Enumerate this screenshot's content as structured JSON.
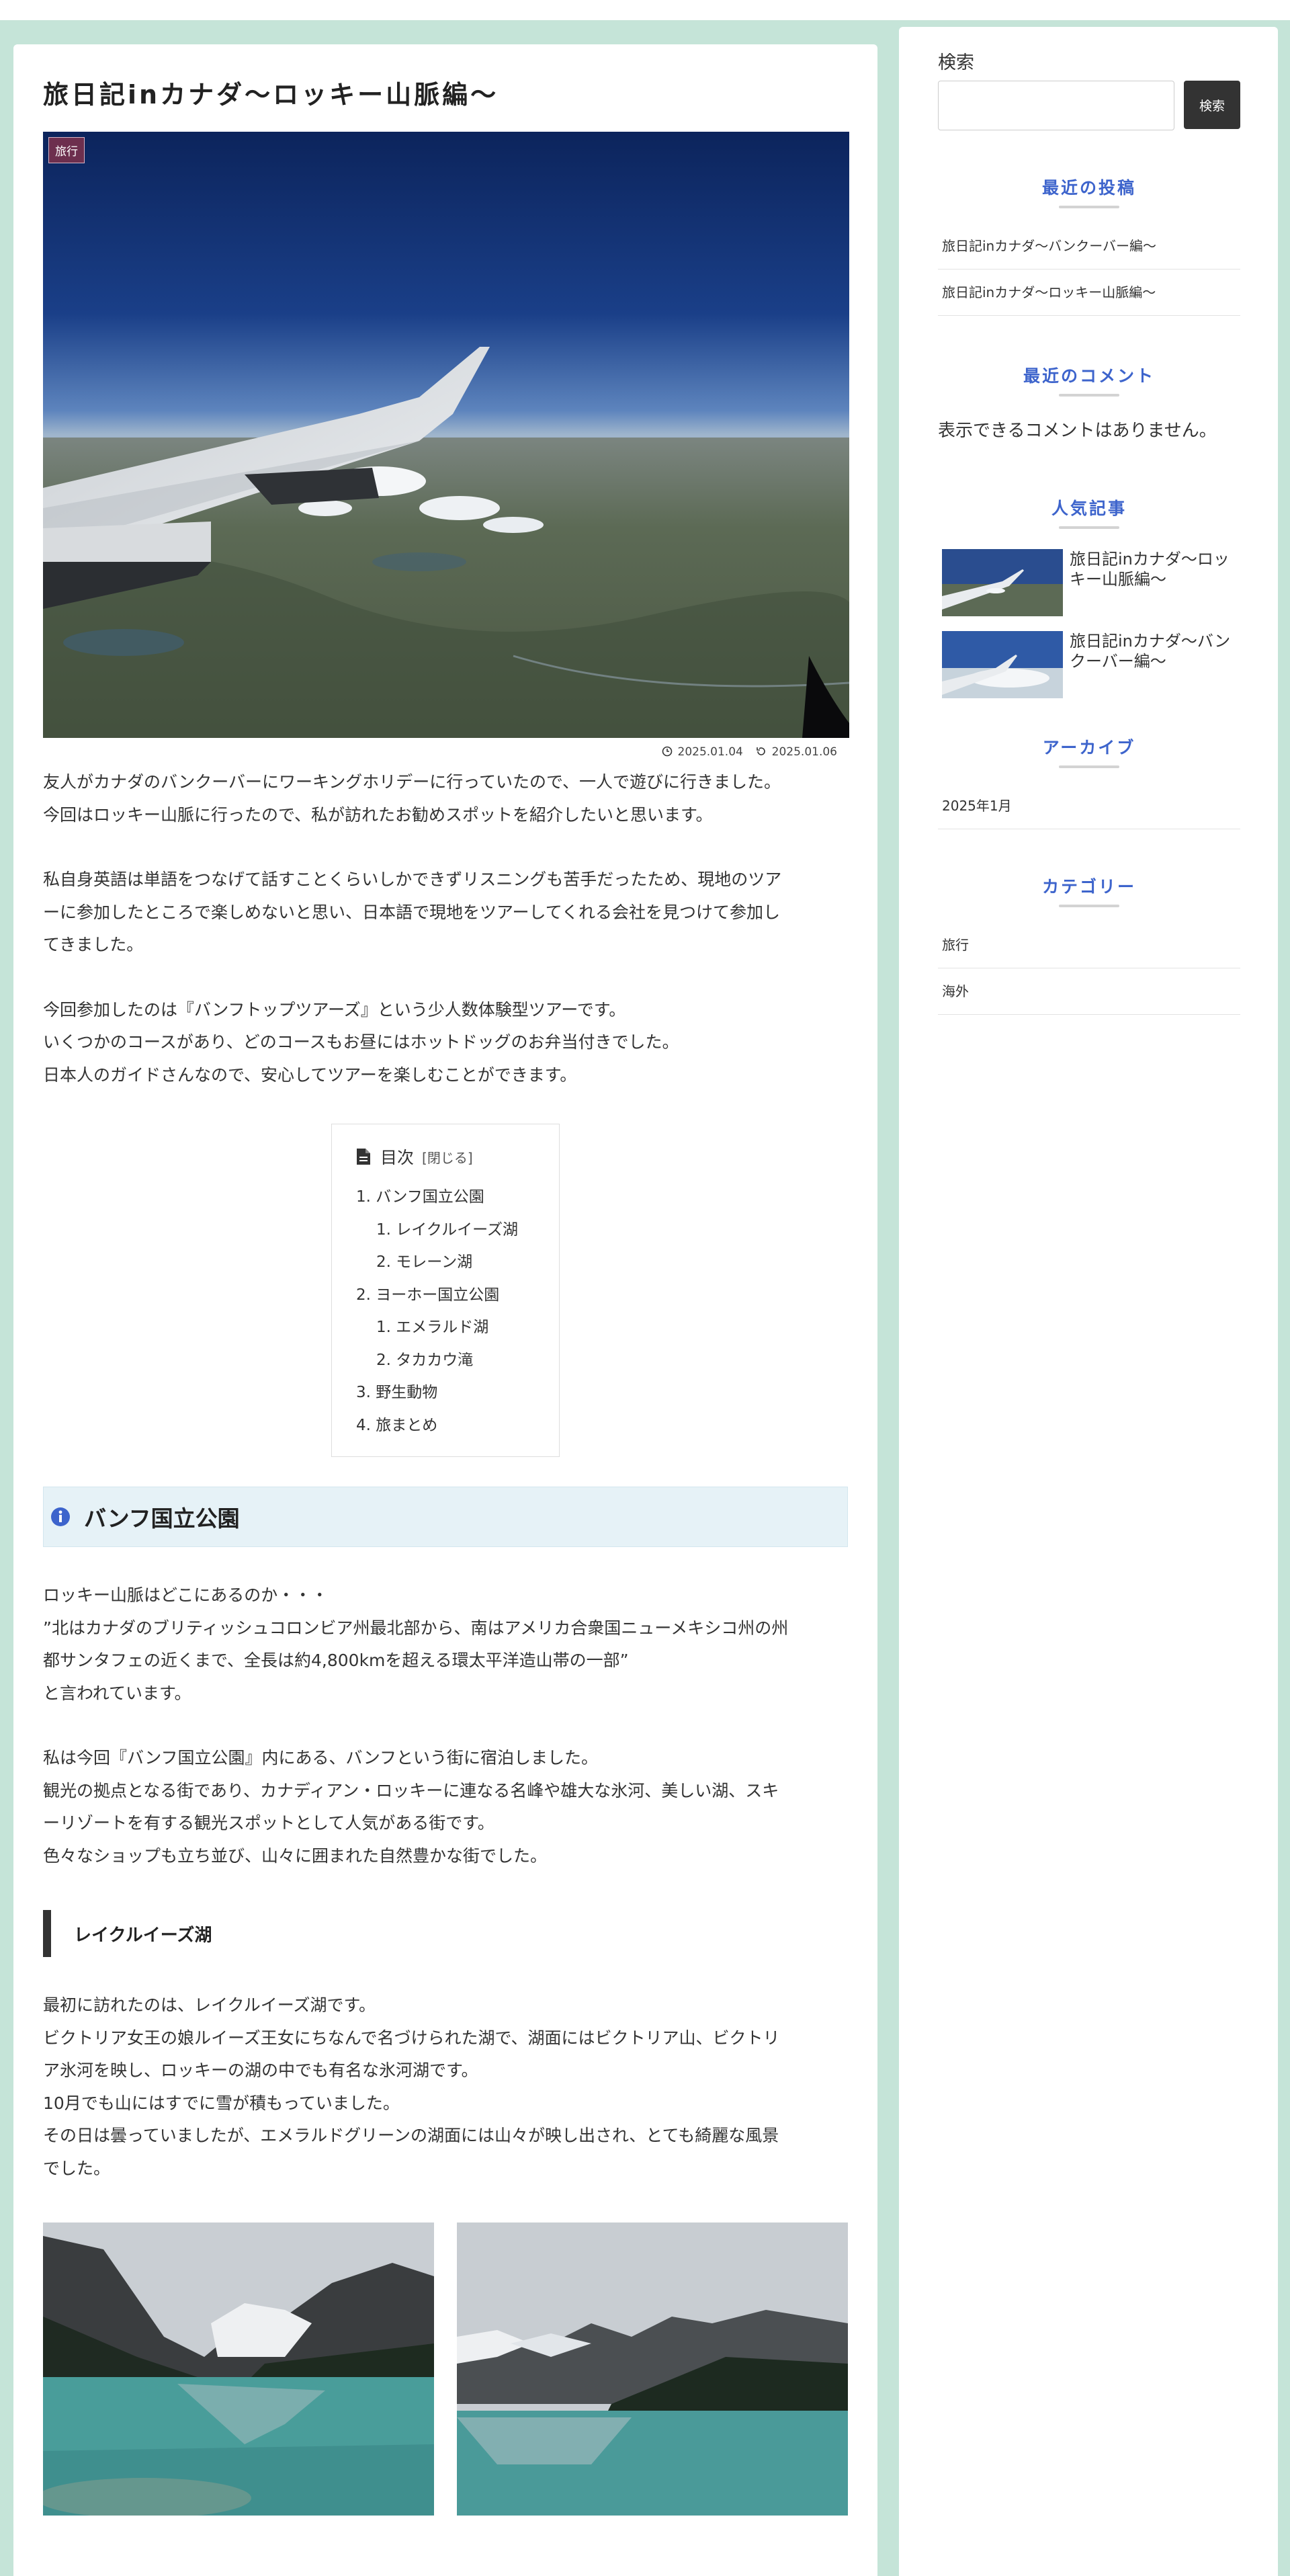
{
  "article": {
    "title": "旅日記inカナダ〜ロッキー山脈編〜",
    "category_badge": "旅行",
    "published": "2025.01.04",
    "updated": "2025.01.06",
    "intro": [
      "友人がカナダのバンクーバーにワーキングホリデーに行っていたので、一人で遊びに行きました。",
      "今回はロッキー山脈に行ったので、私が訪れたお勧めスポットを紹介したいと思います。",
      "私自身英語は単語をつなげて話すことくらいしかできずリスニングも苦手だったため、現地のツア",
      "ーに参加したところで楽しめないと思い、日本語で現地をツアーしてくれる会社を見つけて参加し",
      "てきました。",
      "今回参加したのは『バンフトップツアーズ』という少人数体験型ツアーです。",
      "いくつかのコースがあり、どのコースもお昼にはホットドッグのお弁当付きでした。",
      "日本人のガイドさんなので、安心してツアーを楽しむことができます。"
    ],
    "toc": {
      "title": "目次",
      "toggle": "[閉じる]",
      "items": [
        "1. バンフ国立公園",
        "1. レイクルイーズ湖",
        "2. モレーン湖",
        "2. ヨーホー国立公園",
        "1. エメラルド湖",
        "2. タカカウ滝",
        "3. 野生動物",
        "4. 旅まとめ"
      ]
    },
    "section1_heading": "バンフ国立公園",
    "section1_body": [
      "ロッキー山脈はどこにあるのか・・・",
      "”北はカナダのブリティッシュコロンビア州最北部から、南はアメリカ合衆国ニューメキシコ州の州",
      "都サンタフェの近くまで、全長は約4,800kmを超える環太平洋造山帯の一部”",
      "と言われています。",
      "私は今回『バンフ国立公園』内にある、バンフという街に宿泊しました。",
      "観光の拠点となる街であり、カナディアン・ロッキーに連なる名峰や雄大な氷河、美しい湖、スキ",
      "ーリゾートを有する観光スポットとして人気がある街です。",
      "色々なショップも立ち並び、山々に囲まれた自然豊かな街でした。"
    ],
    "subsection1_heading": "レイクルイーズ湖",
    "subsection1_body": [
      "最初に訪れたのは、レイクルイーズ湖です。",
      "ビクトリア女王の娘ルイーズ王女にちなんで名づけられた湖で、湖面にはビクトリア山、ビクトリ",
      "ア氷河を映し、ロッキーの湖の中でも有名な氷河湖です。",
      "10月でも山にはすでに雪が積もっていました。",
      "その日は曇っていましたが、エメラルドグリーンの湖面には山々が映し出され、とても綺麗な風景",
      "でした。"
    ]
  },
  "sidebar": {
    "search_label": "検索",
    "search_value": "",
    "search_button": "検索",
    "recent_posts_title": "最近の投稿",
    "recent_posts": [
      "旅日記inカナダ〜バンクーバー編〜",
      "旅日記inカナダ〜ロッキー山脈編〜"
    ],
    "recent_comments_title": "最近のコメント",
    "no_comments": "表示できるコメントはありません。",
    "popular_title": "人気記事",
    "popular": [
      "旅日記inカナダ〜ロッキー山脈編〜",
      "旅日記inカナダ〜バンクーバー編〜"
    ],
    "archive_title": "アーカイブ",
    "archives": [
      "2025年1月"
    ],
    "category_title": "カテゴリー",
    "categories": [
      "旅行",
      "海外"
    ]
  },
  "icons": [
    "clock-icon",
    "update-icon",
    "document-icon",
    "info-icon"
  ],
  "colors": {
    "background": "#c5e4d8",
    "accent_blue": "#3d64cc",
    "badge": "#6d2f4e",
    "heading_bg": "#e6f2f7",
    "button": "#333333"
  }
}
